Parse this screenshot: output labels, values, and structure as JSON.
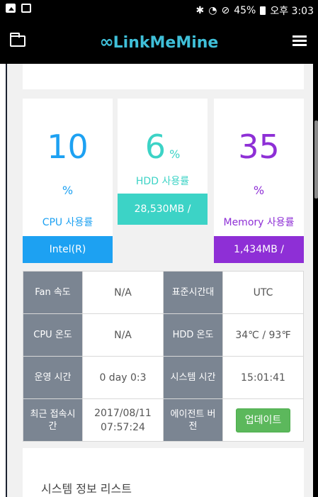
{
  "status_bar": {
    "battery": "45%",
    "time": "오후 3:03"
  },
  "app": {
    "logo": "LinkMeMine"
  },
  "stats": {
    "cpu": {
      "value": "10",
      "unit": "%",
      "label": "CPU 사용률",
      "detail": "Intel(R)",
      "color": "#1da1f2"
    },
    "hdd": {
      "value": "6",
      "unit": "%",
      "label": "HDD 사용률",
      "detail": "28,530MB /",
      "color": "#3cd3c6"
    },
    "memory": {
      "value": "35",
      "unit": "%",
      "label": "Memory 사용률",
      "detail": "1,434MB /",
      "color": "#8e2fd6"
    }
  },
  "info": {
    "fan_label": "Fan 속도",
    "fan_value": "N/A",
    "tz_label": "표준시간대",
    "tz_value": "UTC",
    "cpu_temp_label": "CPU 온도",
    "cpu_temp_value": "N/A",
    "hdd_temp_label": "HDD 온도",
    "hdd_temp_value": "34℃ / 93℉",
    "uptime_label": "운영 시간",
    "uptime_value": "0 day 0:3",
    "sys_time_label": "시스템 시간",
    "sys_time_value": "15:01:41",
    "last_conn_label": "최근 접속시간",
    "last_conn_date": "2017/08/11",
    "last_conn_time": "07:57:24",
    "agent_label": "에이전트 버전",
    "update_button": "업데이트"
  },
  "list_section": {
    "title": "시스템 정보 리스트"
  }
}
